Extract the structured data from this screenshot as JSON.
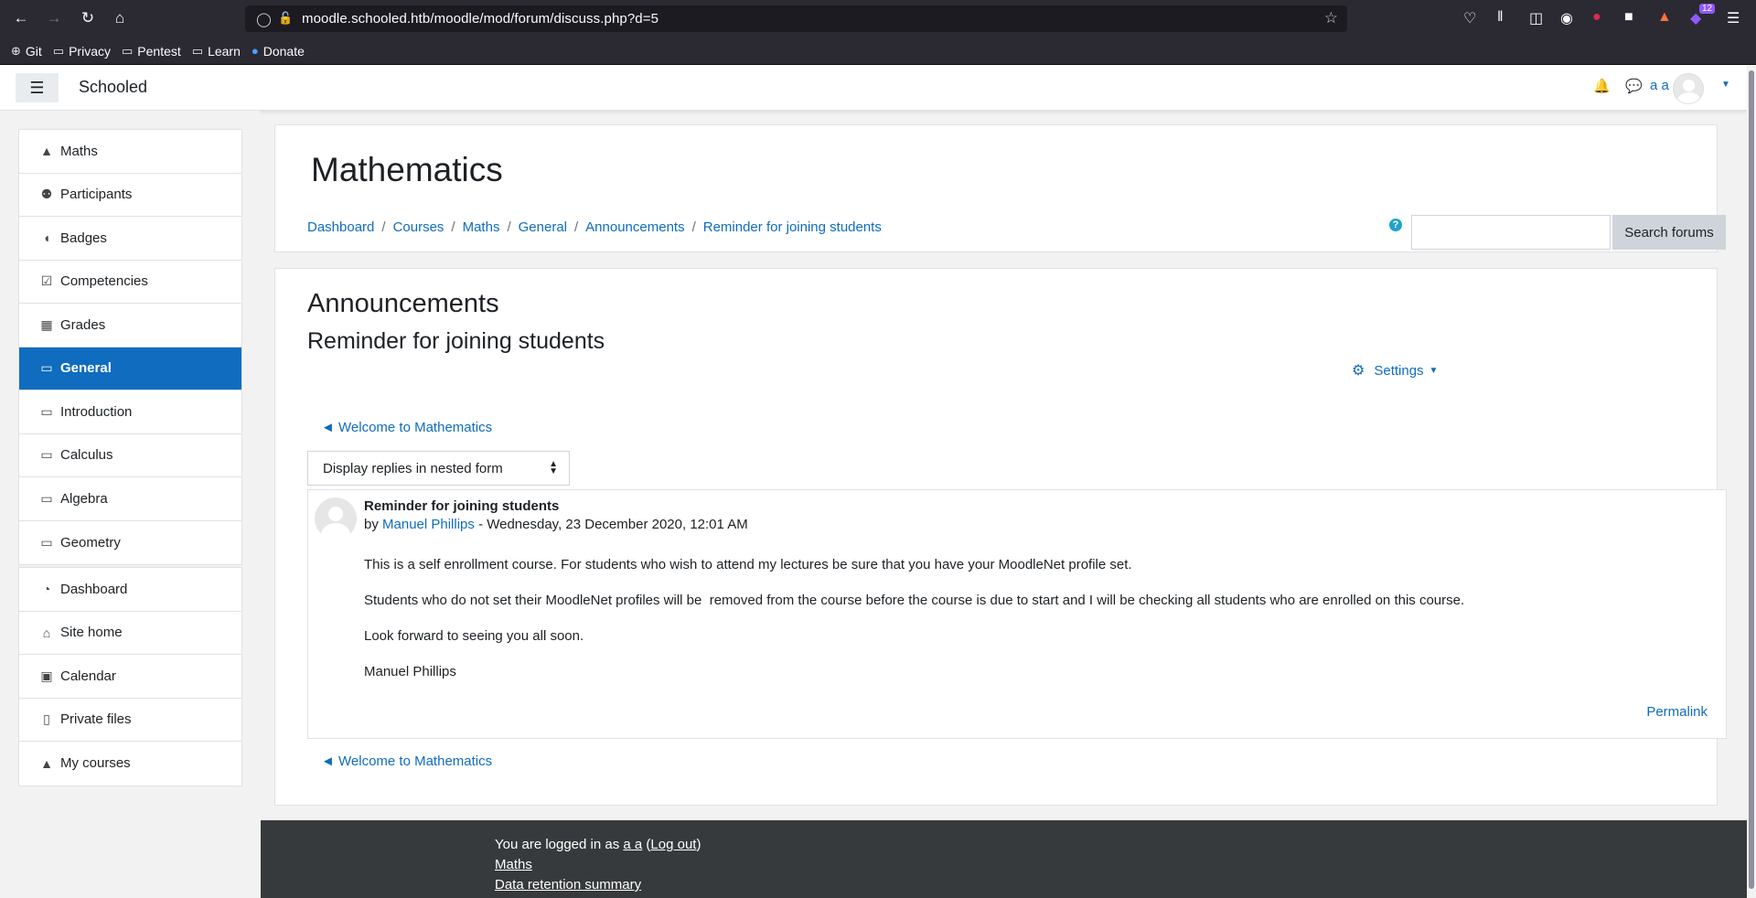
{
  "browser": {
    "url": "moodle.schooled.htb/moodle/mod/forum/discuss.php?d=5",
    "badge_count": "12",
    "bookmarks": [
      {
        "label": "Git",
        "icon": "globe-icon"
      },
      {
        "label": "Privacy",
        "icon": "folder-icon"
      },
      {
        "label": "Pentest",
        "icon": "folder-icon"
      },
      {
        "label": "Learn",
        "icon": "folder-icon"
      },
      {
        "label": "Donate",
        "icon": "donate-icon"
      }
    ]
  },
  "navbar": {
    "brand": "Schooled",
    "user_name": "a a"
  },
  "sidebar": {
    "course_items": [
      {
        "label": "Maths",
        "icon": "graduation-cap-icon"
      },
      {
        "label": "Participants",
        "icon": "users-icon"
      },
      {
        "label": "Badges",
        "icon": "shield-icon"
      },
      {
        "label": "Competencies",
        "icon": "checkbox-icon"
      },
      {
        "label": "Grades",
        "icon": "table-icon"
      },
      {
        "label": "General",
        "icon": "folder-icon",
        "active": true
      },
      {
        "label": "Introduction",
        "icon": "folder-icon"
      },
      {
        "label": "Calculus",
        "icon": "folder-icon"
      },
      {
        "label": "Algebra",
        "icon": "folder-icon"
      },
      {
        "label": "Geometry",
        "icon": "folder-icon"
      }
    ],
    "site_items": [
      {
        "label": "Dashboard",
        "icon": "dashboard-icon"
      },
      {
        "label": "Site home",
        "icon": "home-icon"
      },
      {
        "label": "Calendar",
        "icon": "calendar-icon"
      },
      {
        "label": "Private files",
        "icon": "file-icon"
      },
      {
        "label": "My courses",
        "icon": "graduation-cap-icon"
      }
    ]
  },
  "header": {
    "title": "Mathematics",
    "breadcrumbs": [
      "Dashboard",
      "Courses",
      "Maths",
      "General",
      "Announcements",
      "Reminder for joining students"
    ],
    "search_button": "Search forums",
    "search_value": ""
  },
  "discussion": {
    "forum_title": "Announcements",
    "discussion_title": "Reminder for joining students",
    "settings_label": "Settings",
    "prev_link": "◄ Welcome to Mathematics",
    "display_mode": "Display replies in nested form",
    "post": {
      "subject": "Reminder for joining students",
      "by": "by",
      "author": "Manuel Phillips",
      "date": " - Wednesday, 23 December 2020, 12:01 AM",
      "paragraphs": [
        "This is a self enrollment course. For students who wish to attend my lectures be sure that you have your MoodleNet profile set.",
        "Students who do not set their MoodleNet profiles will be  removed from the course before the course is due to start and I will be checking all students who are enrolled on this course.",
        "Look forward to seeing you all soon.",
        "Manuel Phillips"
      ],
      "permalink": "Permalink"
    }
  },
  "footer": {
    "logged_in_prefix": "You are logged in as ",
    "user": "a a",
    "logout": "Log out",
    "link1": "Maths",
    "link2": "Data retention summary"
  },
  "colors": {
    "accent": "#0f6cbf",
    "browser_bg": "#2b2a33",
    "footer_bg": "#373a3c"
  }
}
